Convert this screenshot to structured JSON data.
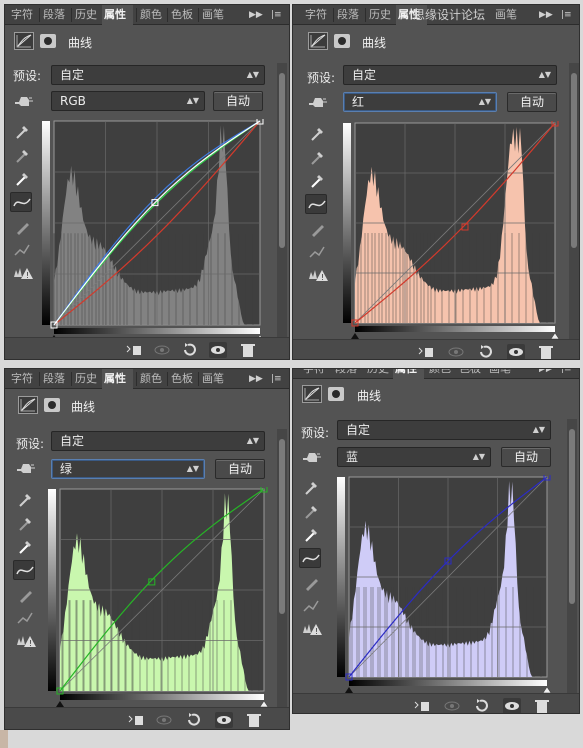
{
  "tabs": {
    "characters": "字符",
    "paragraph": "段落",
    "history": "历史",
    "properties": "属性",
    "color": "颜色",
    "swatches": "色板",
    "brush": "画笔"
  },
  "watermark": "思缘设计论坛",
  "panel_title": "曲线",
  "preset_label": "预设:",
  "preset_value": "自定",
  "auto_label": "自动",
  "channels": {
    "rgb": "RGB",
    "red": "红",
    "green": "绿",
    "blue": "蓝"
  },
  "colors": {
    "panel_bg": "#535353",
    "graph_bg": "#3f3f3f",
    "red_hist": "#f6c3ad",
    "green_hist": "#c9f7ae",
    "blue_hist": "#cfccf7",
    "gray_hist": "#8a8a8a",
    "red_curve": "#d23a2c",
    "green_curve": "#26b526",
    "blue_curve": "#2b2bc4",
    "focus_border": "#5a7fb0"
  },
  "icons": {
    "tabbar_controls": "collapse-and-menu-icon",
    "tools": [
      "sample-black-eyedropper-icon",
      "sample-gray-eyedropper-icon",
      "sample-white-eyedropper-icon",
      "curve-points-icon",
      "pencil-icon",
      "smooth-icon",
      "clipping-warning-icon"
    ],
    "footer": [
      "clip-to-layer-icon",
      "view-previous-icon",
      "reset-icon",
      "visibility-icon",
      "delete-icon"
    ]
  }
}
